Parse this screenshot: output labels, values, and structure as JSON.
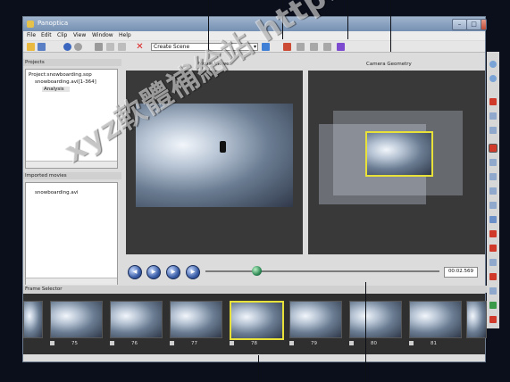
{
  "window": {
    "title": "Panoptica"
  },
  "menu": [
    "File",
    "Edit",
    "Clip",
    "View",
    "Window",
    "Help"
  ],
  "toolbar": {
    "scene_select": "Create Scene"
  },
  "projects": {
    "header": "Projects",
    "items": [
      "Project:snowboarding.sop",
      "snowboarding.avi[1-364]",
      "Analysis"
    ]
  },
  "imported": {
    "header": "Imported movies",
    "items": [
      "snowboarding.avi"
    ]
  },
  "movie_viewer": {
    "label": "Movie Viewer"
  },
  "camera_geometry": {
    "label": "Camera Geometry"
  },
  "playback": {
    "timecode": "00:02.569",
    "position_fraction": 0.2
  },
  "frame_selector": {
    "header": "Frame Selector",
    "frames": [
      "75",
      "76",
      "77",
      "78",
      "79",
      "80",
      "81"
    ],
    "selected": "78"
  },
  "watermark": "xyz軟體補給站 http://31.to",
  "colors": {
    "selection": "#e8e13a",
    "viewer_bg": "#393939"
  }
}
